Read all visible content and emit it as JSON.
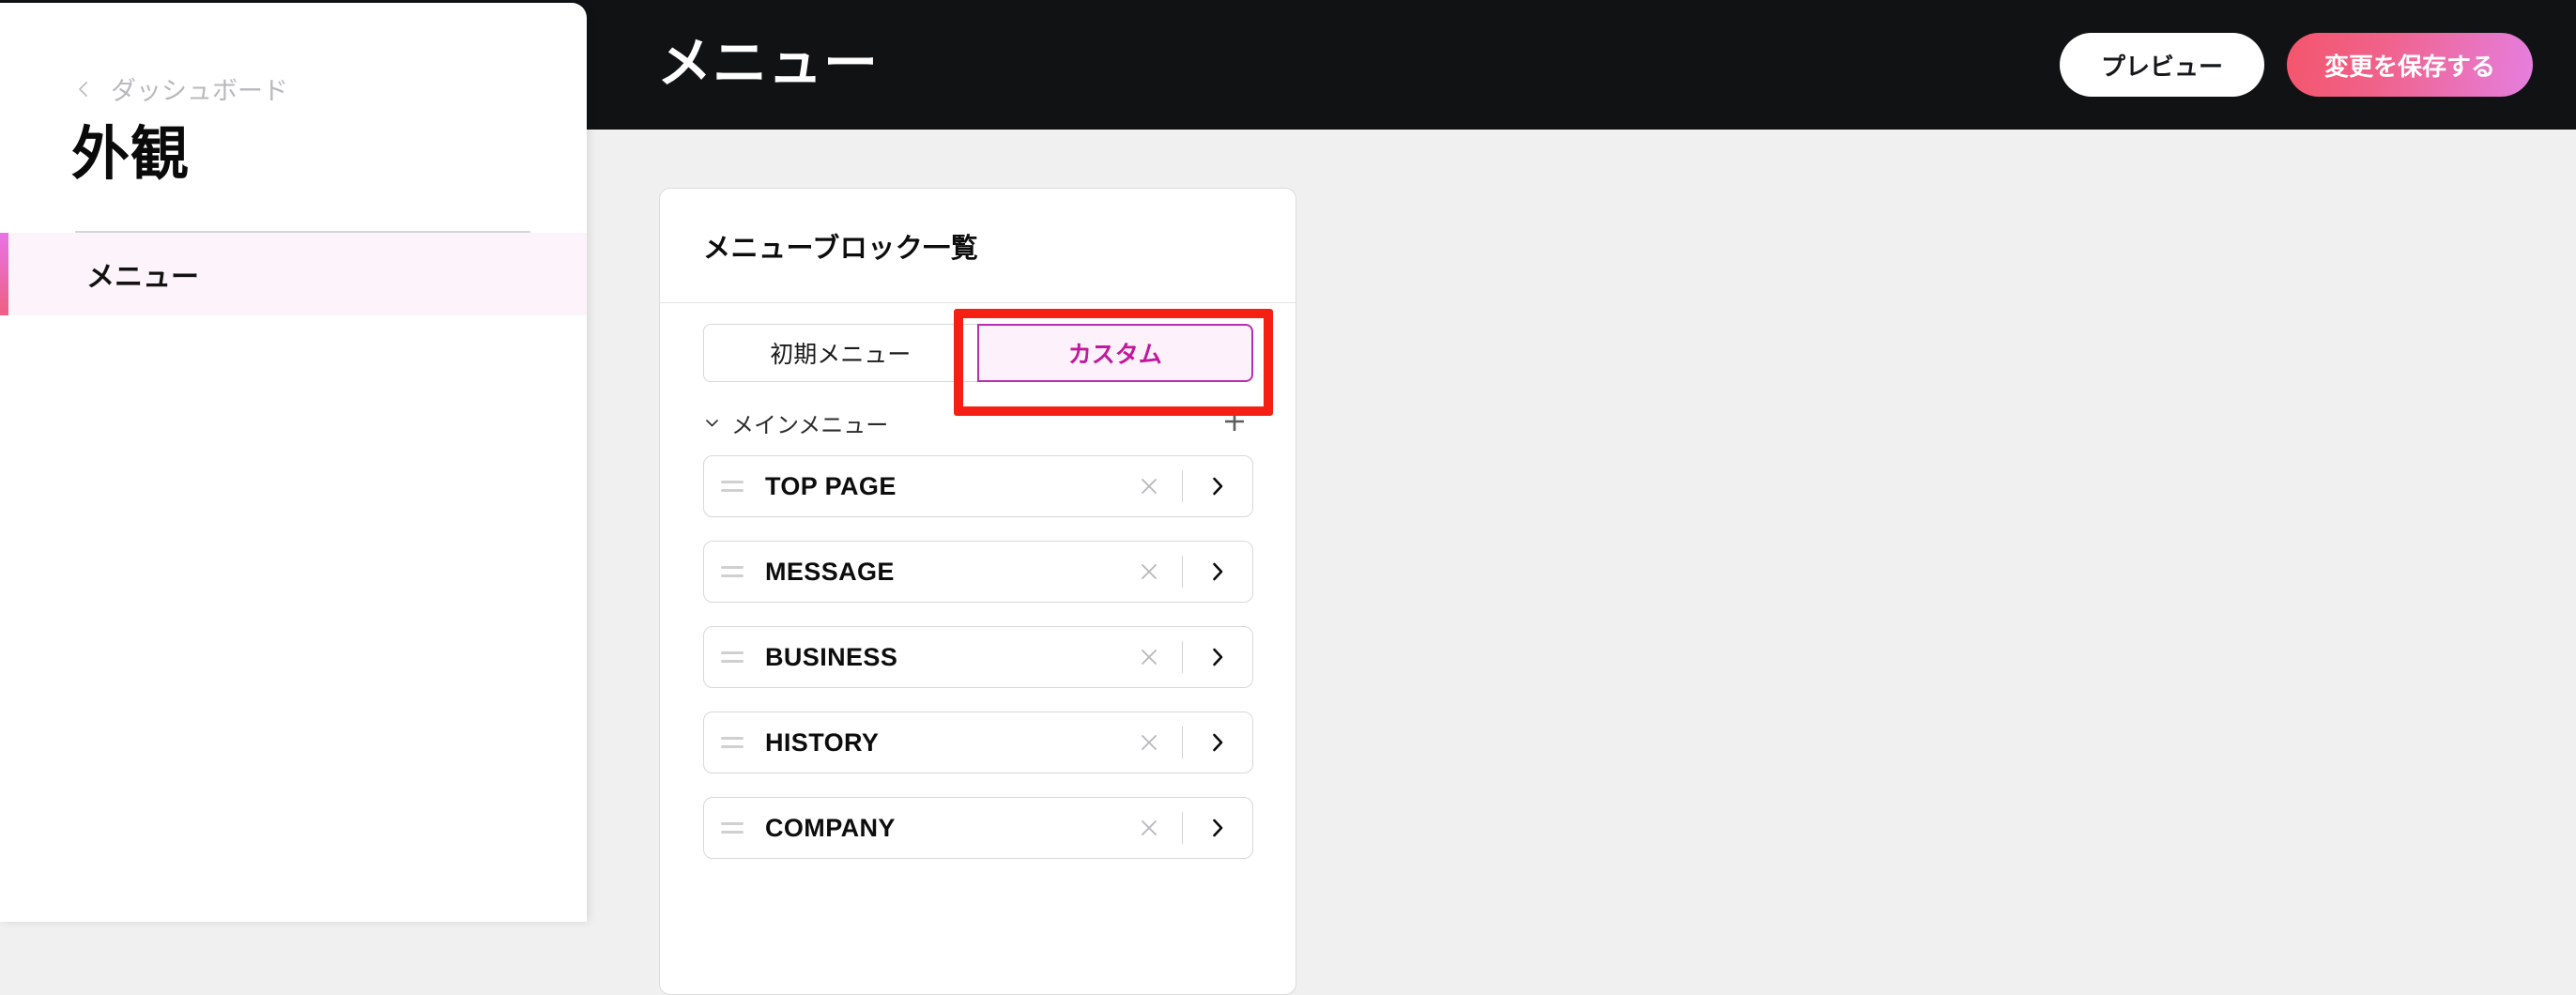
{
  "topbar": {
    "title": "メニュー",
    "preview_label": "プレビュー",
    "save_label": "変更を保存する",
    "background": "#111213",
    "save_gradient_from": "#f4556c",
    "save_gradient_to": "#e57fe0"
  },
  "sidebar": {
    "breadcrumb": {
      "label": "ダッシュボード",
      "icon": "chevron-left-icon"
    },
    "page_title": "外観",
    "items": [
      {
        "label": "メニュー",
        "active": true,
        "accent_from": "#e973e8",
        "accent_to": "#ef5f80",
        "active_background": "#fdf3fa"
      }
    ]
  },
  "main": {
    "card": {
      "header_title": "メニューブロック一覧",
      "tabs": [
        {
          "label": "初期メニュー",
          "active": false
        },
        {
          "label": "カスタム",
          "active": true
        }
      ],
      "section": {
        "label": "メインメニュー",
        "toggle_icon": "chevron-down-icon",
        "expanded": true,
        "add_icon": "plus-icon"
      },
      "menu_items": [
        {
          "label": "TOP PAGE"
        },
        {
          "label": "MESSAGE"
        },
        {
          "label": "BUSINESS"
        },
        {
          "label": "HISTORY"
        },
        {
          "label": "COMPANY"
        }
      ],
      "row_icons": {
        "drag": "drag-handle-icon",
        "remove": "close-icon",
        "open": "chevron-right-icon"
      }
    }
  },
  "annotation": {
    "color": "#f32013",
    "target": "カスタム"
  }
}
